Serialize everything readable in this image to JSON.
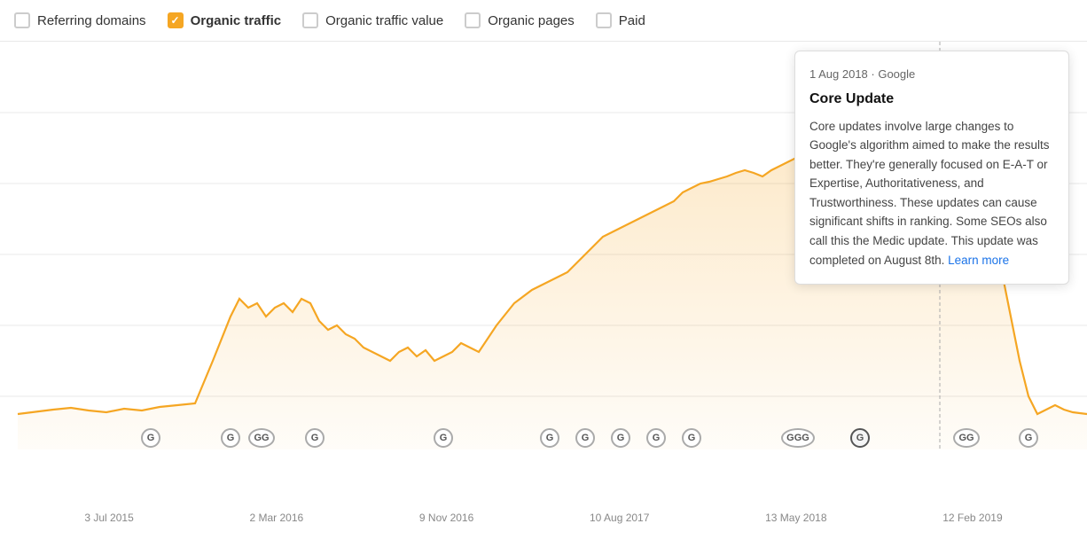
{
  "checkboxes": [
    {
      "id": "referring-domains",
      "label": "Referring domains",
      "checked": false,
      "bold": false
    },
    {
      "id": "organic-traffic",
      "label": "Organic traffic",
      "checked": true,
      "bold": true
    },
    {
      "id": "organic-traffic-value",
      "label": "Organic traffic value",
      "checked": false,
      "bold": false
    },
    {
      "id": "organic-pages",
      "label": "Organic pages",
      "checked": false,
      "bold": false
    },
    {
      "id": "paid",
      "label": "Paid",
      "checked": false,
      "bold": false
    }
  ],
  "tooltip": {
    "header": "1 Aug 2018 · Google",
    "title": "Core Update",
    "body": "Core updates involve large changes to Google's algorithm aimed to make the results better. They're generally focused on E-A-T or Expertise, Authoritativeness, and Trustworthiness. These updates can cause significant shifts in ranking. Some SEOs also call this the Medic update. This update was completed on August 8th.",
    "link_text": "Learn more"
  },
  "x_labels": [
    "3 Jul 2015",
    "2 Mar 2016",
    "9 Nov 2016",
    "10 Aug 2017",
    "13 May 2018",
    "12 Feb 2019"
  ],
  "colors": {
    "orange": "#f5a623",
    "orange_fill": "rgba(245,166,35,0.15)",
    "link_blue": "#1a73e8"
  }
}
